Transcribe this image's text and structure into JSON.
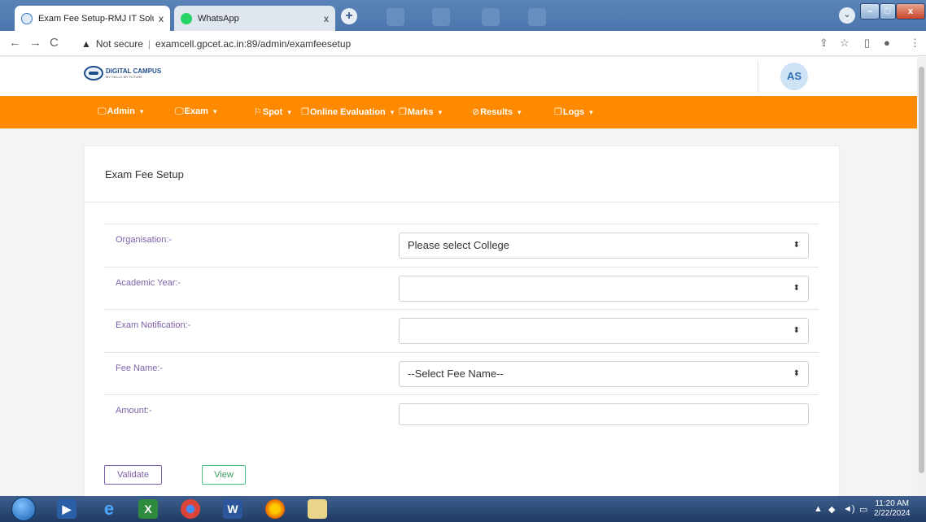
{
  "browser": {
    "tabs": [
      {
        "title": "Exam Fee Setup-RMJ IT Solutions",
        "active": true
      },
      {
        "title": "WhatsApp",
        "active": false
      }
    ],
    "close_glyph": "x",
    "new_tab_glyph": "+",
    "security_label": "Not secure",
    "url": "examcell.gpcet.ac.in:89/admin/examfeesetup"
  },
  "header": {
    "logo_title": "DIGITAL CAMPUS",
    "logo_tagline": "MY SKILLS MY FUTURE",
    "avatar_initials": "AS"
  },
  "nav": {
    "items": [
      {
        "label": "Admin",
        "icon": "monitor-icon"
      },
      {
        "label": "Exam",
        "icon": "monitor-icon"
      },
      {
        "label": "Spot",
        "icon": "flag-icon"
      },
      {
        "label": "Online Evaluation",
        "icon": "copy-icon"
      },
      {
        "label": "Marks",
        "icon": "copy-icon"
      },
      {
        "label": "Results",
        "icon": "circle-slash-icon"
      },
      {
        "label": "Logs",
        "icon": "copy-icon"
      }
    ]
  },
  "form": {
    "title": "Exam Fee Setup",
    "fields": [
      {
        "label": "Organisation:-",
        "value": "Please select College",
        "type": "select"
      },
      {
        "label": "Academic Year:-",
        "value": "",
        "type": "select"
      },
      {
        "label": "Exam Notification:-",
        "value": "",
        "type": "select"
      },
      {
        "label": "Fee Name:-",
        "value": "--Select Fee Name--",
        "type": "select"
      },
      {
        "label": "Amount:-",
        "value": "",
        "type": "text"
      }
    ],
    "validate_label": "Validate",
    "view_label": "View"
  },
  "taskbar": {
    "time": "11:20 AM",
    "date": "2/22/2024"
  },
  "colors": {
    "nav_bg": "#ff8a00",
    "label_purple": "#7b5fa8",
    "view_green": "#4fbf83"
  }
}
